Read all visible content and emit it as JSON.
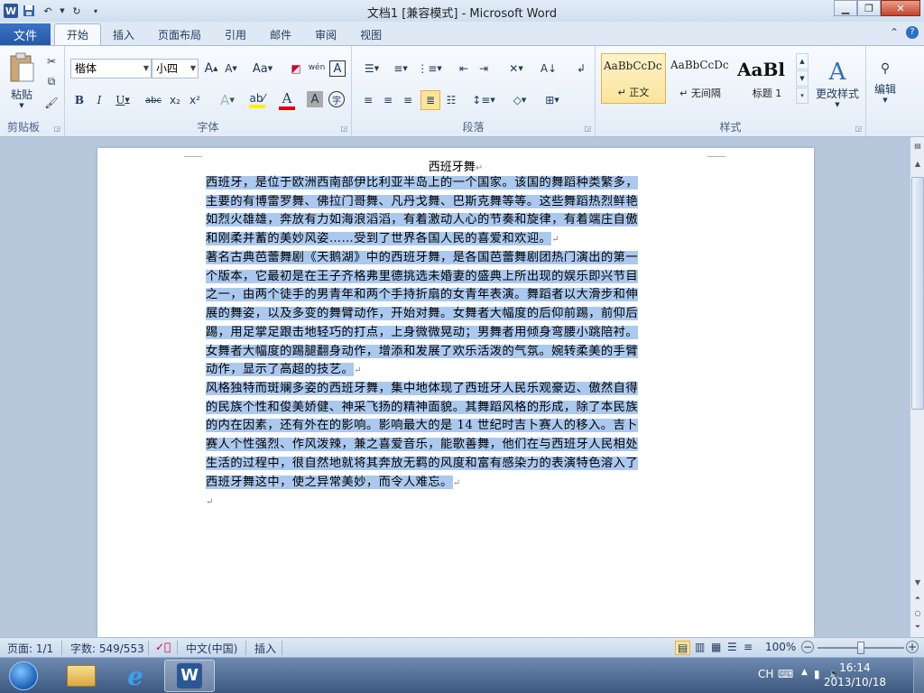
{
  "window": {
    "title": "文档1 [兼容模式] - Microsoft Word",
    "logo_letter": "W"
  },
  "tabs": {
    "file": "文件",
    "items": [
      "开始",
      "插入",
      "页面布局",
      "引用",
      "邮件",
      "审阅",
      "视图"
    ],
    "active": "开始"
  },
  "ribbon": {
    "clipboard": {
      "label": "剪贴板",
      "paste": "粘贴"
    },
    "font": {
      "label": "字体",
      "font_name": "楷体",
      "font_size": "小四",
      "grow": "A",
      "shrink": "A",
      "case": "Aa",
      "wen": "wén",
      "border_a": "A",
      "bold": "B",
      "italic": "I",
      "underline": "U",
      "strike": "abc",
      "sub": "x₂",
      "sup": "x²",
      "shade_a": "A",
      "fontcolor_a": "A",
      "charshade_a": "A",
      "enclose": "字"
    },
    "paragraph": {
      "label": "段落"
    },
    "styles": {
      "label": "样式",
      "items": [
        {
          "preview": "AaBbCcDc",
          "name": "正文"
        },
        {
          "preview": "AaBbCcDc",
          "name": "无间隔"
        },
        {
          "preview": "AaBl",
          "name": "标题 1"
        }
      ],
      "change_styles": "更改样式"
    },
    "editing": {
      "label": "编辑"
    }
  },
  "document": {
    "title": "西班牙舞",
    "para1": [
      "西班牙，是位于欧洲西南部伊比利亚半岛上的一个国家。该国的舞蹈种类繁多，",
      "主要的有博雷罗舞、佛拉门哥舞、凡丹戈舞、巴斯克舞等等。这些舞蹈热烈鲜艳",
      "如烈火雄雄，奔放有力如海浪滔滔，有着激动人心的节奏和旋律，有着端庄自傲",
      "和刚柔并蓄的美妙风姿……受到了世界各国人民的喜爱和欢迎。"
    ],
    "para2": [
      "著名古典芭蕾舞剧《天鹅湖》中的西班牙舞，是各国芭蕾舞剧团热门演出的第一",
      "个版本，它最初是在王子齐格弗里德挑选未婚妻的盛典上所出现的娱乐即兴节目",
      "之一，由两个徒手的男青年和两个手持折扇的女青年表演。舞蹈者以大滑步和伸",
      "展的舞姿，以及多变的舞臂动作，开始对舞。女舞者大幅度的后仰前踢，前仰后",
      "踢，用足掌足跟击地轻巧的打点，上身微微晃动；男舞者用倾身弯腰小跳陪衬。",
      "女舞者大幅度的踢腿翻身动作，增添和发展了欢乐活泼的气氛。婉转柔美的手臂",
      "动作，显示了高超的技艺。"
    ],
    "para3": [
      "风格独特而斑斓多姿的西班牙舞，集中地体现了西班牙人民乐观豪迈、傲然自得",
      "的民族个性和俊美娇健、神采飞扬的精神面貌。其舞蹈风格的形成，除了本民族",
      "的内在因素，还有外在的影响。影响最大的是 14 世纪时吉卜赛人的移入。吉卜",
      "赛人个性强烈、作风泼辣，兼之喜爱音乐，能歌善舞，他们在与西班牙人民相处",
      "生活的过程中，很自然地就将其奔放无羁的风度和富有感染力的表演特色溶入了",
      "西班牙舞这中，使之异常美妙，而令人难忘。"
    ],
    "para_mark": "↵"
  },
  "status": {
    "page": "页面: 1/1",
    "words": "字数: 549/553",
    "language": "中文(中国)",
    "mode": "插入",
    "zoom": "100%"
  },
  "taskbar": {
    "ime": "CH",
    "time": "16:14",
    "date": "2013/10/18"
  },
  "colors": {
    "selection": "#abc9ef",
    "file_tab": "#2b5797",
    "ribbon_bg": "#e3ecf7"
  }
}
